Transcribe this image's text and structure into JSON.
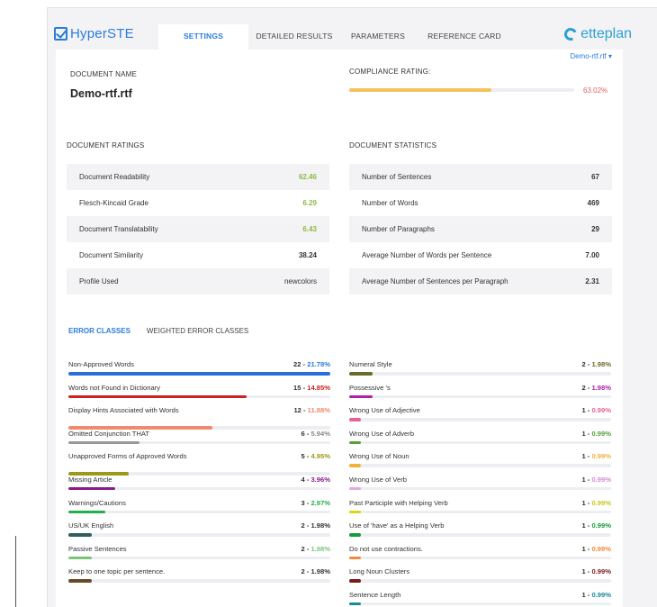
{
  "app": {
    "logo": "HyperSTE",
    "brand": "etteplan"
  },
  "tabs": [
    {
      "label": "SETTINGS",
      "active": true
    },
    {
      "label": "DETAILED RESULTS",
      "active": false
    },
    {
      "label": "PARAMETERS",
      "active": false
    },
    {
      "label": "REFERENCE CARD",
      "active": false
    }
  ],
  "document": {
    "name_label": "DOCUMENT NAME",
    "name": "Demo-rtf.rtf",
    "selector": "Demo-rtf.rtf ▾",
    "compliance_label": "COMPLIANCE RATING:",
    "compliance_value": "63.02%",
    "compliance_fraction": 0.6302,
    "compliance_color": "#f6c15a"
  },
  "ratings": {
    "title": "DOCUMENT RATINGS",
    "rows": [
      {
        "label": "Document Readability",
        "value": "62.46",
        "style": "green"
      },
      {
        "label": "Flesch-Kincaid Grade",
        "value": "6.29",
        "style": "green"
      },
      {
        "label": "Document Translatability",
        "value": "6.43",
        "style": "green"
      },
      {
        "label": "Document Similarity",
        "value": "38.24",
        "style": "bold"
      },
      {
        "label": "Profile Used",
        "value": "newcolors",
        "style": "plain"
      }
    ]
  },
  "statistics": {
    "title": "DOCUMENT STATISTICS",
    "rows": [
      {
        "label": "Number of Sentences",
        "value": "67"
      },
      {
        "label": "Number of Words",
        "value": "469"
      },
      {
        "label": "Number of Paragraphs",
        "value": "29"
      },
      {
        "label": "Average Number of Words per Sentence",
        "value": "7.00"
      },
      {
        "label": "Average Number of Sentences per Paragraph",
        "value": "2.31"
      }
    ]
  },
  "error_tabs": [
    {
      "label": "ERROR CLASSES",
      "active": true
    },
    {
      "label": "WEIGHTED ERROR CLASSES",
      "active": false
    }
  ],
  "errors_left": [
    {
      "name": "Non-Approved Words",
      "count": "22",
      "pct": "21.78%",
      "fraction": 1.0,
      "color": "#2a6fd6",
      "pct_color": "#2a7ddb",
      "two_line": false
    },
    {
      "name": "Words not Found in Dictionary",
      "count": "15",
      "pct": "14.85%",
      "fraction": 0.68,
      "color": "#cc2222",
      "pct_color": "#cc2222",
      "two_line": false
    },
    {
      "name": "Display Hints Associated with Words",
      "count": "12",
      "pct": "11.88%",
      "fraction": 0.55,
      "color": "#f08a6c",
      "pct_color": "#f08a6c",
      "two_line": true
    },
    {
      "name": "Omitted Conjunction THAT",
      "count": "6",
      "pct": "5.94%",
      "fraction": 0.27,
      "color": "#999999",
      "pct_color": "#888888",
      "two_line": false
    },
    {
      "name": "Unapproved Forms of Approved Words",
      "count": "5",
      "pct": "4.95%",
      "fraction": 0.23,
      "color": "#9a9a1a",
      "pct_color": "#9a9a1a",
      "two_line": true
    },
    {
      "name": "Missing Article",
      "count": "4",
      "pct": "3.96%",
      "fraction": 0.18,
      "color": "#8b1a8b",
      "pct_color": "#8b1a8b",
      "two_line": false
    },
    {
      "name": "Warnings/Cautions",
      "count": "3",
      "pct": "2.97%",
      "fraction": 0.14,
      "color": "#22b04a",
      "pct_color": "#22b04a",
      "two_line": false
    },
    {
      "name": "US/UK English",
      "count": "2",
      "pct": "1.98%",
      "fraction": 0.09,
      "color": "#2f5e5e",
      "pct_color": "#333333",
      "two_line": false
    },
    {
      "name": "Passive Sentences",
      "count": "2",
      "pct": "1.98%",
      "fraction": 0.09,
      "color": "#7cc47c",
      "pct_color": "#7cc47c",
      "two_line": false
    },
    {
      "name": "Keep to one topic per sentence.",
      "count": "2",
      "pct": "1.98%",
      "fraction": 0.09,
      "color": "#6b4a2a",
      "pct_color": "#333333",
      "two_line": false
    }
  ],
  "errors_right": [
    {
      "name": "Numeral Style",
      "count": "2",
      "pct": "1.98%",
      "fraction": 0.09,
      "color": "#6b6b2a",
      "pct_color": "#6b6b2a"
    },
    {
      "name": "Possessive 's",
      "count": "2",
      "pct": "1.98%",
      "fraction": 0.09,
      "color": "#b020b0",
      "pct_color": "#b020b0"
    },
    {
      "name": "Wrong Use of Adjective",
      "count": "1",
      "pct": "0.99%",
      "fraction": 0.045,
      "color": "#e8609a",
      "pct_color": "#e8609a"
    },
    {
      "name": "Wrong Use of Adverb",
      "count": "1",
      "pct": "0.99%",
      "fraction": 0.045,
      "color": "#5aa03a",
      "pct_color": "#5aa03a"
    },
    {
      "name": "Wrong Use of Noun",
      "count": "1",
      "pct": "0.99%",
      "fraction": 0.045,
      "color": "#f2b23a",
      "pct_color": "#f2b23a"
    },
    {
      "name": "Wrong Use of Verb",
      "count": "1",
      "pct": "0.99%",
      "fraction": 0.045,
      "color": "#e6a6e6",
      "pct_color": "#d68ad6"
    },
    {
      "name": "Past Participle with Helping Verb",
      "count": "1",
      "pct": "0.99%",
      "fraction": 0.045,
      "color": "#d6d61a",
      "pct_color": "#c8c81a"
    },
    {
      "name": "Use of 'have' as a Helping Verb",
      "count": "1",
      "pct": "0.99%",
      "fraction": 0.045,
      "color": "#1a9a3a",
      "pct_color": "#1a9a3a"
    },
    {
      "name": "Do not use contractions.",
      "count": "1",
      "pct": "0.99%",
      "fraction": 0.045,
      "color": "#f58a3a",
      "pct_color": "#f58a3a"
    },
    {
      "name": "Long Noun Clusters",
      "count": "1",
      "pct": "0.99%",
      "fraction": 0.045,
      "color": "#7a1a1a",
      "pct_color": "#7a1a1a"
    },
    {
      "name": "Sentence Length",
      "count": "1",
      "pct": "0.99%",
      "fraction": 0.045,
      "color": "#1a8a9a",
      "pct_color": "#1a8a9a"
    }
  ]
}
